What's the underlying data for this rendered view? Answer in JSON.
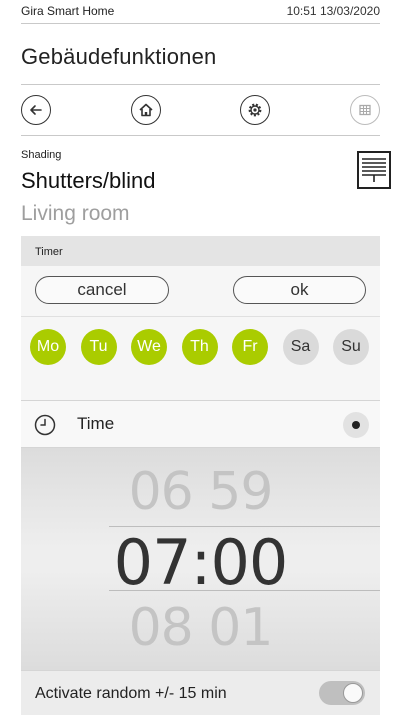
{
  "status_bar": {
    "app_name": "Gira Smart Home",
    "datetime": "10:51 13/03/2020"
  },
  "app_title": "Gebäudefunktionen",
  "nav": {
    "icons": [
      "back-arrow-icon",
      "home-icon",
      "settings-gear-icon",
      "grid-icon"
    ]
  },
  "device": {
    "category": "Shading",
    "name": "Shutters/blind",
    "room": "Living room",
    "icon": "blind-icon"
  },
  "timer": {
    "header": "Timer",
    "cancel_label": "cancel",
    "ok_label": "ok",
    "days": [
      {
        "label": "Mo",
        "active": true
      },
      {
        "label": "Tu",
        "active": true
      },
      {
        "label": "We",
        "active": true
      },
      {
        "label": "Th",
        "active": true
      },
      {
        "label": "Fr",
        "active": true
      },
      {
        "label": "Sa",
        "active": false
      },
      {
        "label": "Su",
        "active": false
      }
    ],
    "time_label": "Time",
    "picker": {
      "prev": "06 59",
      "current": "07:00",
      "next": "08 01"
    },
    "random_label": "Activate random +/- 15 min",
    "random_enabled": false
  },
  "colors": {
    "active_day": "#aacc00",
    "inactive_day": "#dadada"
  }
}
